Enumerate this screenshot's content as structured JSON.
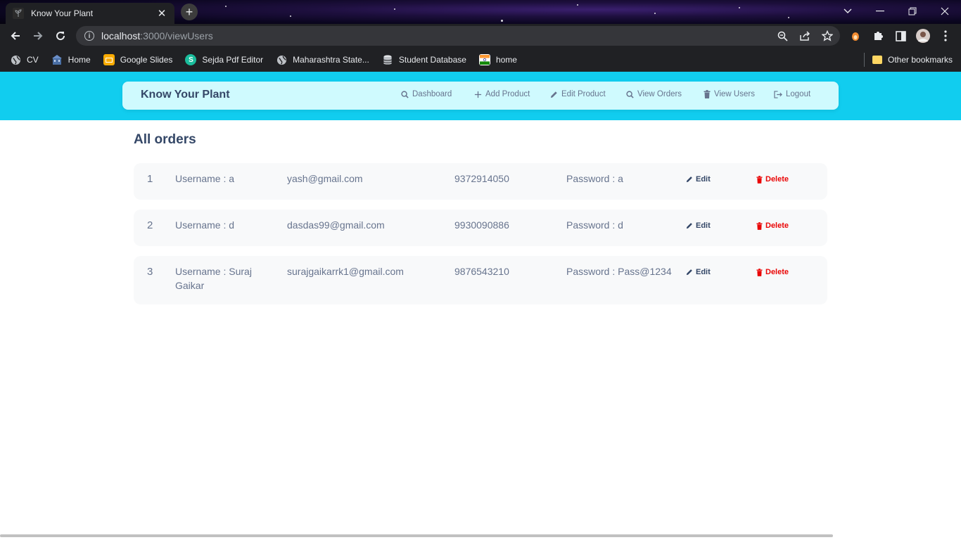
{
  "browser": {
    "tab_title": "Know Your Plant",
    "url_host": "localhost",
    "url_path": ":3000/viewUsers",
    "bookmarks": [
      {
        "label": "CV",
        "icon": "globe-icon"
      },
      {
        "label": "Home",
        "icon": "building-icon"
      },
      {
        "label": "Google Slides",
        "icon": "slides-icon"
      },
      {
        "label": "Sejda Pdf Editor",
        "icon": "sejda-icon"
      },
      {
        "label": "Maharashtra State...",
        "icon": "globe-icon"
      },
      {
        "label": "Student Database",
        "icon": "database-icon"
      },
      {
        "label": "home",
        "icon": "flag-icon"
      }
    ],
    "other_bookmarks": "Other bookmarks"
  },
  "navbar": {
    "brand": "Know Your Plant",
    "links": [
      {
        "label": "Dashboard",
        "icon": "search-icon"
      },
      {
        "label": "Add Product",
        "icon": "plus-icon"
      },
      {
        "label": "Edit Product",
        "icon": "pencil-icon"
      },
      {
        "label": "View Orders",
        "icon": "search-icon"
      },
      {
        "label": "View Users",
        "icon": "trash-icon"
      },
      {
        "label": "Logout",
        "icon": "logout-icon"
      }
    ]
  },
  "page": {
    "heading": "All orders",
    "edit_label": "Edit",
    "delete_label": "Delete",
    "rows": [
      {
        "index": "1",
        "username": "Username : a",
        "email": "yash@gmail.com",
        "phone": "9372914050",
        "password": "Password : a"
      },
      {
        "index": "2",
        "username": "Username : d",
        "email": "dasdas99@gmail.com",
        "phone": "9930090886",
        "password": "Password : d"
      },
      {
        "index": "3",
        "username": "Username : Suraj Gaikar",
        "email": "surajgaikarrk1@gmail.com",
        "phone": "9876543210",
        "password": "Password : Pass@1234"
      }
    ]
  },
  "colors": {
    "hero": "#11cdef",
    "navbar": "#cffafe",
    "text_dark": "#344767",
    "text_muted": "#67748e",
    "danger": "#ea0606"
  }
}
